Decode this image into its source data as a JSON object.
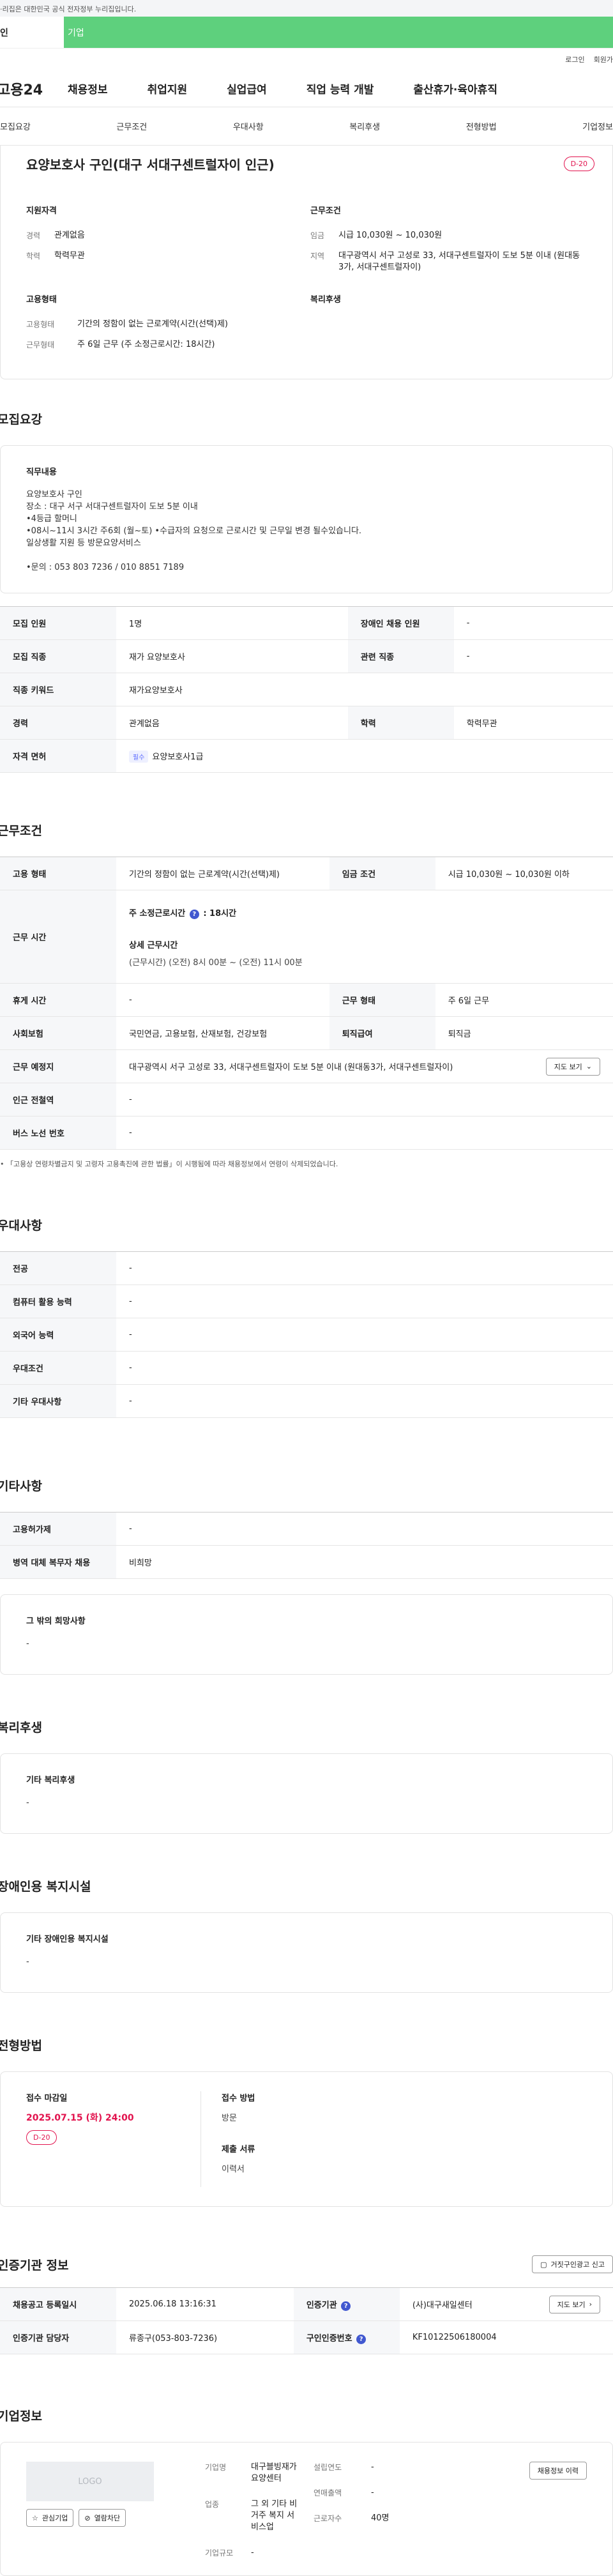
{
  "gov_banner": "·리집은 대한민국 공식 전자정부 누리집입니다.",
  "top_tabs": [
    "인",
    "기업"
  ],
  "util": [
    "로그인",
    "회원가"
  ],
  "gnb": {
    "logo": "고용24",
    "menu": [
      "채용정보",
      "취업지원",
      "실업급여",
      "직업 능력 개발",
      "출산휴가·육아휴직"
    ]
  },
  "snb": [
    "모집요강",
    "근무조건",
    "우대사항",
    "복리후생",
    "전형방법",
    "기업정보"
  ],
  "header": {
    "title": "요양보호사 구인(대구 서대구센트럴자이 인근)",
    "dday": "D-20",
    "qual_title": "지원자격",
    "qual": [
      {
        "k": "경력",
        "v": "관계없음"
      },
      {
        "k": "학력",
        "v": "학력무관"
      }
    ],
    "cond_title": "근무조건",
    "cond": [
      {
        "k": "임금",
        "v": "시급 10,030원 ~ 10,030원"
      },
      {
        "k": "지역",
        "v": "대구광역시 서구 고성로 33, 서대구센트럴자이 도보 5분 이내 (원대동3가, 서대구센트럴자이)"
      }
    ],
    "emp_title": "고용형태",
    "emp": [
      {
        "k": "고용형태",
        "v": "기간의 정함이 없는 근로계약(시간(선택)제)"
      },
      {
        "k": "근무형태",
        "v": "주 6일 근무 (주 소정근로시간: 18시간)"
      }
    ],
    "welfare_title": "복리후생"
  },
  "recruit": {
    "title": "모집요강",
    "duty_title": "직무내용",
    "duty_text": "요양보호사 구인\n장소 : 대구 서구 서대구센트럴자이 도보 5분 이내\n•4등급 할머니\n•08시~11시 3시간  주6회 (월~토) •수급자의 요청으로 근로시간 및 근무일 변경 될수있습니다.\n일상생활 지원 등 방문요양서비스\n\n•문의 :  053 803 7236 / 010 8851 7189",
    "rows": [
      [
        "모집 인원",
        "1명",
        "장애인 채용 인원",
        "-"
      ],
      [
        "모집 직종",
        "재가 요양보호사",
        "관련 직종",
        "-"
      ]
    ],
    "kw_label": "직종 키워드",
    "kw": "재가요양보호사",
    "edu_row": [
      "경력",
      "관계없음",
      "학력",
      "학력무관"
    ],
    "lic_label": "자격 면허",
    "lic_badge": "필수",
    "lic": "요양보호사1급"
  },
  "work": {
    "title": "근무조건",
    "r1": [
      "고용 형태",
      "기간의 정함이 없는 근로계약(시간(선택)제)",
      "임금 조건",
      "시급 10,030원 ~ 10,030원 이하"
    ],
    "time_label": "근무 시간",
    "time_l1a": "주 소정근로시간",
    "time_l1b": ": 18시간",
    "time_l2": "상세 근무시간",
    "time_l3": "(근무시간) (오전) 8시 00분 ~ (오전) 11시 00분",
    "r2": [
      "휴게 시간",
      "-",
      "근무 형태",
      "주 6일 근무"
    ],
    "r3": [
      "사회보험",
      "국민연금, 고용보험, 산재보험, 건강보험",
      "퇴직급여",
      "퇴직금"
    ],
    "loc_label": "근무 예정지",
    "loc": "대구광역시 서구 고성로 33, 서대구센트럴자이 도보 5분 이내 (원대동3가, 서대구센트럴자이)",
    "map_btn": "지도 보기",
    "r4": [
      "인근 전철역",
      "-"
    ],
    "r5": [
      "버스 노선 번호",
      "-"
    ],
    "note": "• 「고용상 연령차별금지 및 고령자 고용촉진에 관한 법률」이 시행됨에 따라 채용정보에서 연령이 삭제되었습니다."
  },
  "pref": {
    "title": "우대사항",
    "rows": [
      [
        "전공",
        "-"
      ],
      [
        "컴퓨터 활용 능력",
        "-"
      ],
      [
        "외국어 능력",
        "-"
      ],
      [
        "우대조건",
        "-"
      ],
      [
        "기타 우대사항",
        "-"
      ]
    ]
  },
  "etc": {
    "title": "기타사항",
    "rows": [
      [
        "고용허가제",
        "-"
      ],
      [
        "병역 대체 복무자 채용",
        "비희망"
      ]
    ],
    "box_title": "그 밖의 희망사항",
    "box_v": "-"
  },
  "welfare": {
    "title": "복리후생",
    "box_title": "기타 복리후생",
    "box_v": "-"
  },
  "disab": {
    "title": "장애인용 복지시설",
    "box_title": "기타 장애인용 복지시설",
    "box_v": "-"
  },
  "selection": {
    "title": "전형방법",
    "deadline_label": "접수 마감일",
    "deadline": "2025.07.15 (화) 24:00",
    "dday": "D-20",
    "method_label": "접수 방법",
    "method": "방문",
    "docs_label": "제출 서류",
    "docs": "이력서"
  },
  "agency": {
    "title": "인증기관 정보",
    "report_btn": "거짓구인광고 신고",
    "r1": [
      "채용공고 등록일시",
      "2025.06.18 13:16:31",
      "인증기관",
      "(사)대구새일센터"
    ],
    "map_btn": "지도 보기",
    "r2": [
      "인증기관 담당자",
      "류종구(053-803-7236)",
      "구인인증번호",
      "KF10122506180004"
    ]
  },
  "company": {
    "title": "기업정보",
    "logo": "LOGO",
    "fav_btn": "관심기업",
    "block_btn": "열람차단",
    "history_btn": "채용정보 이력",
    "name_k": "기업명",
    "name_v": "대구블빙재가요양센터",
    "ind_k": "업종",
    "ind_v": "그 외 기타 비거주 복지 서비스업",
    "size_k": "기업규모",
    "size_v": "-",
    "year_k": "설립연도",
    "year_v": "-",
    "sales_k": "연매출액",
    "sales_v": "-",
    "emp_k": "근로자수",
    "emp_v": "40명"
  }
}
